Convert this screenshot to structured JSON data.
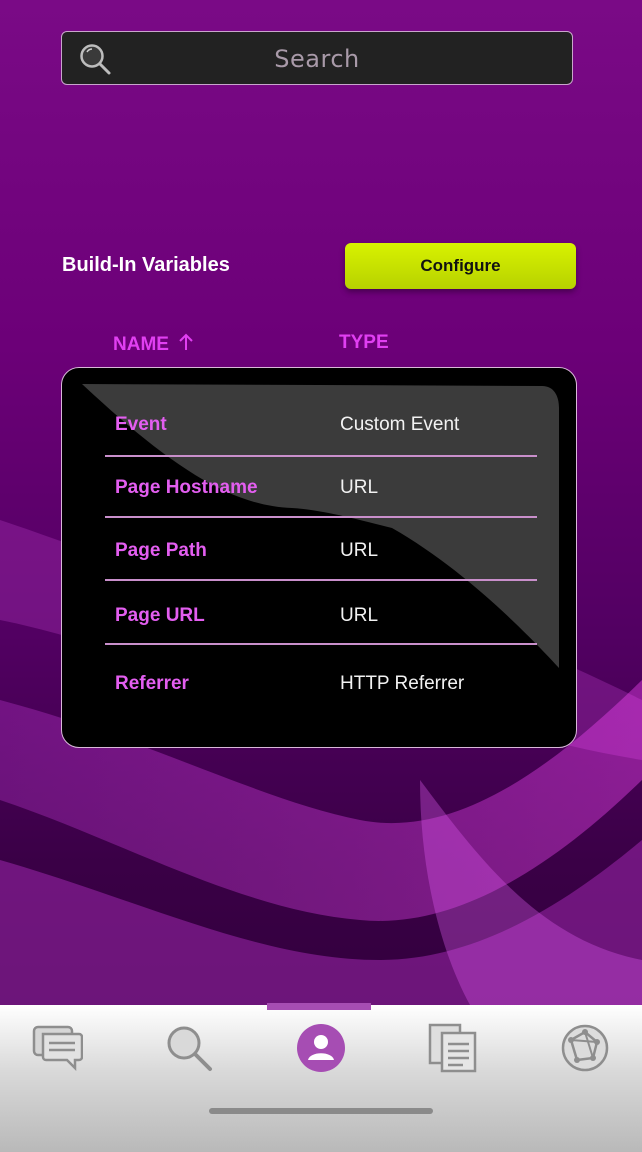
{
  "search": {
    "placeholder": "Search",
    "icon": "search-icon"
  },
  "section": {
    "title": "Build-In Variables",
    "configure_label": "Configure"
  },
  "table": {
    "columns": [
      {
        "label": "NAME",
        "sort": "ascending",
        "sort_icon": "arrow-up-icon"
      },
      {
        "label": "TYPE"
      }
    ],
    "rows": [
      {
        "name": "Event",
        "type": "Custom Event"
      },
      {
        "name": "Page Hostname",
        "type": "URL"
      },
      {
        "name": "Page Path",
        "type": "URL"
      },
      {
        "name": "Page URL",
        "type": "URL"
      },
      {
        "name": "Referrer",
        "type": "HTTP Referrer"
      }
    ]
  },
  "bottom_nav": {
    "items": [
      {
        "icon": "chat-icon",
        "active": false
      },
      {
        "icon": "search-icon",
        "active": false
      },
      {
        "icon": "profile-icon",
        "active": true
      },
      {
        "icon": "documents-icon",
        "active": false
      },
      {
        "icon": "globe-network-icon",
        "active": false
      }
    ]
  },
  "colors": {
    "accent": "#e13ff2",
    "button": "#c8e000",
    "background": "#6c0078",
    "active_nav": "#a64db3"
  }
}
